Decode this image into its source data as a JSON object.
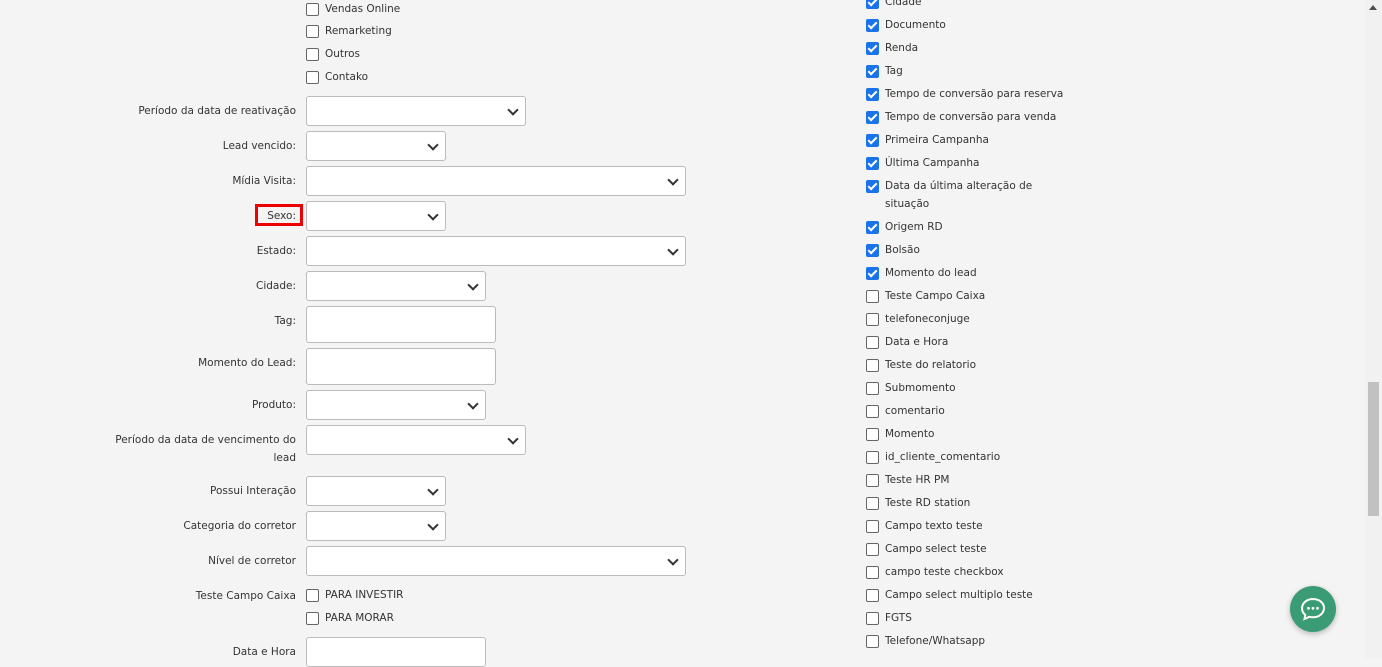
{
  "top_checkboxes": [
    {
      "label": "Vendas Online",
      "checked": false
    },
    {
      "label": "Remarketing",
      "checked": false
    },
    {
      "label": "Outros",
      "checked": false
    },
    {
      "label": "Contako",
      "checked": false
    }
  ],
  "fields": {
    "periodo_reativacao": "Período da data de reativação",
    "lead_vencido": "Lead vencido:",
    "midia_visita": "Mídia Visita:",
    "sexo": "Sexo:",
    "estado": "Estado:",
    "cidade": "Cidade:",
    "tag": "Tag:",
    "momento_lead": "Momento do Lead:",
    "produto": "Produto:",
    "periodo_vencimento_1": "Período da data de vencimento do",
    "periodo_vencimento_2": "lead",
    "possui_interacao": "Possui Interação",
    "categoria_corretor": "Categoria do corretor",
    "nivel_corretor": "Nível de corretor",
    "teste_campo_caixa": "Teste Campo Caixa",
    "data_hora": "Data e Hora"
  },
  "caixa_options": [
    {
      "label": "PARA INVESTIR",
      "checked": false
    },
    {
      "label": "PARA MORAR",
      "checked": false
    }
  ],
  "right_columns": [
    {
      "label": "Cidade",
      "checked": true
    },
    {
      "label": "Documento",
      "checked": true
    },
    {
      "label": "Renda",
      "checked": true
    },
    {
      "label": "Tag",
      "checked": true
    },
    {
      "label": "Tempo de conversão para reserva",
      "checked": true
    },
    {
      "label": "Tempo de conversão para venda",
      "checked": true
    },
    {
      "label": "Primeira Campanha",
      "checked": true
    },
    {
      "label": "Última Campanha",
      "checked": true
    },
    {
      "label": "Data da última alteração de",
      "label2": "situação",
      "checked": true
    },
    {
      "label": "Origem RD",
      "checked": true
    },
    {
      "label": "Bolsão",
      "checked": true
    },
    {
      "label": "Momento do lead",
      "checked": true
    },
    {
      "label": "Teste Campo Caixa",
      "checked": false
    },
    {
      "label": "telefoneconjuge",
      "checked": false
    },
    {
      "label": "Data e Hora",
      "checked": false
    },
    {
      "label": "Teste do relatorio",
      "checked": false
    },
    {
      "label": "Submomento",
      "checked": false
    },
    {
      "label": "comentario",
      "checked": false
    },
    {
      "label": "Momento",
      "checked": false
    },
    {
      "label": "id_cliente_comentario",
      "checked": false
    },
    {
      "label": "Teste HR PM",
      "checked": false
    },
    {
      "label": "Teste RD station",
      "checked": false
    },
    {
      "label": "Campo texto teste",
      "checked": false
    },
    {
      "label": "Campo select teste",
      "checked": false
    },
    {
      "label": "campo teste checkbox",
      "checked": false
    },
    {
      "label": "Campo select multiplo teste",
      "checked": false
    },
    {
      "label": "FGTS",
      "checked": false
    },
    {
      "label": "Telefone/Whatsapp",
      "checked": false
    }
  ],
  "colors": {
    "accent": "#1a73e8",
    "chat_button": "#3a9b74",
    "highlight": "#e00000"
  },
  "icons": {
    "chat": "chat-bubble-icon"
  }
}
